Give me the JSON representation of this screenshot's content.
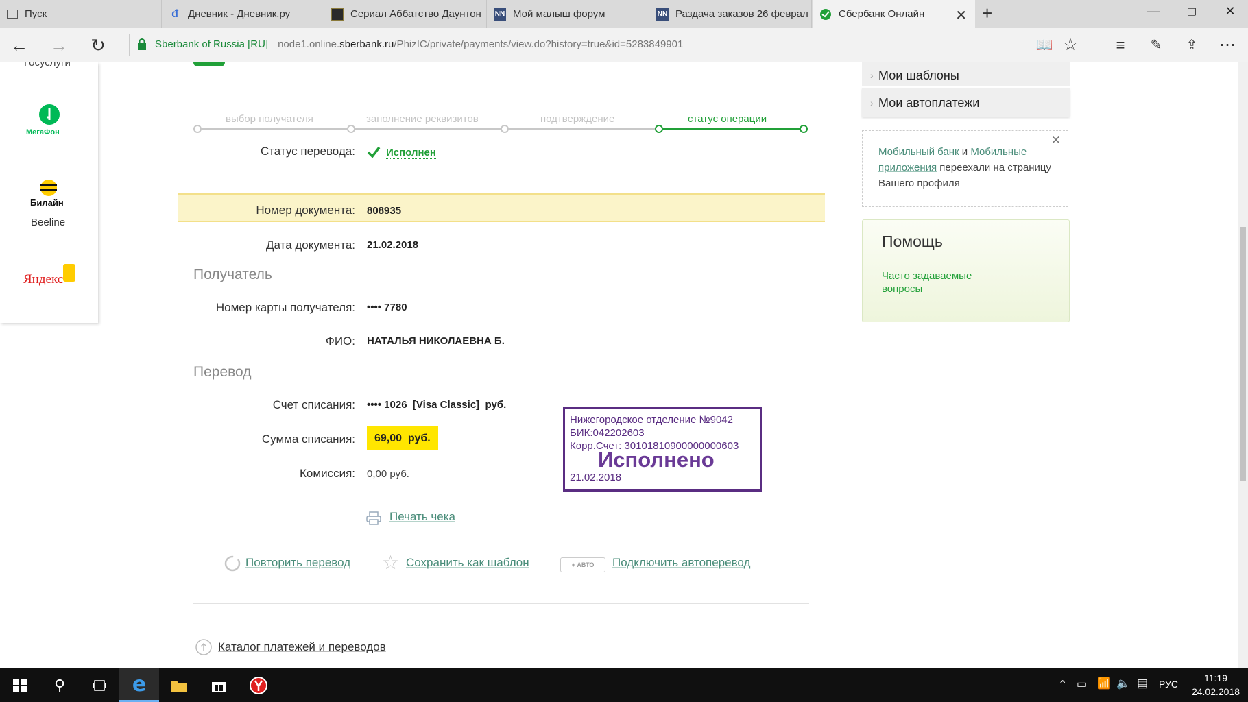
{
  "browser": {
    "tabs": [
      {
        "label": "Пуск",
        "icon": "page-icon"
      },
      {
        "label": "Дневник - Дневник.ру",
        "icon": "dnevnik-icon"
      },
      {
        "label": "Сериал Аббатство Даунтон",
        "icon": "movie-icon"
      },
      {
        "label": "Мой малыш форум",
        "icon": "nn-icon"
      },
      {
        "label": "Раздача заказов 26 феврал",
        "icon": "nn-icon"
      },
      {
        "label": "Сбербанк Онлайн",
        "icon": "sberbank-icon"
      }
    ],
    "new_tab": "+",
    "address": {
      "secure_label": "Sberbank of Russia [RU]",
      "url_prefix": "node1.online.",
      "url_host": "sberbank.ru",
      "url_path": "/PhizIC/private/payments/view.do?history=true&id=5283849901"
    }
  },
  "left_panel": {
    "gosuslugi": "Госуслуги",
    "megafon": "МегаФон",
    "beeline_logo": "Билайн",
    "beeline": "Beeline",
    "yandex": "Яндекс"
  },
  "steps": [
    {
      "label": "выбор получателя",
      "active": false
    },
    {
      "label": "заполнение реквизитов",
      "active": false
    },
    {
      "label": "подтверждение",
      "active": false
    },
    {
      "label": "статус операции",
      "active": true
    }
  ],
  "details": {
    "status_label": "Статус перевода:",
    "status_value": "Исполнен",
    "doc_num_label": "Номер документа:",
    "doc_num_value": "808935",
    "doc_date_label": "Дата документа:",
    "doc_date_value": "21.02.2018",
    "recipient_heading": "Получатель",
    "card_label": "Номер карты получателя:",
    "card_value": "•••• 7780",
    "fio_label": "ФИО:",
    "fio_value": "НАТАЛЬЯ НИКОЛАЕВНА Б.",
    "transfer_heading": "Перевод",
    "account_label": "Счет списания:",
    "account_value": "•••• 1026  [Visa Classic]  руб.",
    "amount_label": "Сумма списания:",
    "amount_value": "69,00  руб.",
    "commission_label": "Комиссия:",
    "commission_value": "0,00 руб."
  },
  "stamp": {
    "line1": "Нижегородское отделение №9042",
    "line2": "БИК:042202603",
    "line3": "Корр.Счет: 30101810900000000603",
    "status": "Исполнено",
    "date": "21.02.2018"
  },
  "actions": {
    "print": "Печать чека",
    "repeat": "Повторить перевод",
    "save_template": "Сохранить как шаблон",
    "auto_badge": "+ АВТО",
    "autopay": "Подключить автоперевод",
    "catalog": "Каталог платежей и переводов"
  },
  "sidebar": {
    "menu": [
      "Мои шаблоны",
      "Мои автоплатежи"
    ],
    "notice": {
      "link1": "Мобильный банк",
      "and": " и ",
      "link2": "Мобильные приложения",
      "rest": " переехали на страницу Вашего профиля"
    },
    "help_title": "Помощь",
    "help_link": "Часто задаваемые вопросы"
  },
  "taskbar": {
    "lang": "РУС",
    "time": "11:19",
    "date": "24.02.2018"
  },
  "colors": {
    "sber_green": "#21a038",
    "highlight_row": "#fbf4c9",
    "amount_bg": "#ffe600",
    "stamp_purple": "#5a2d82"
  }
}
